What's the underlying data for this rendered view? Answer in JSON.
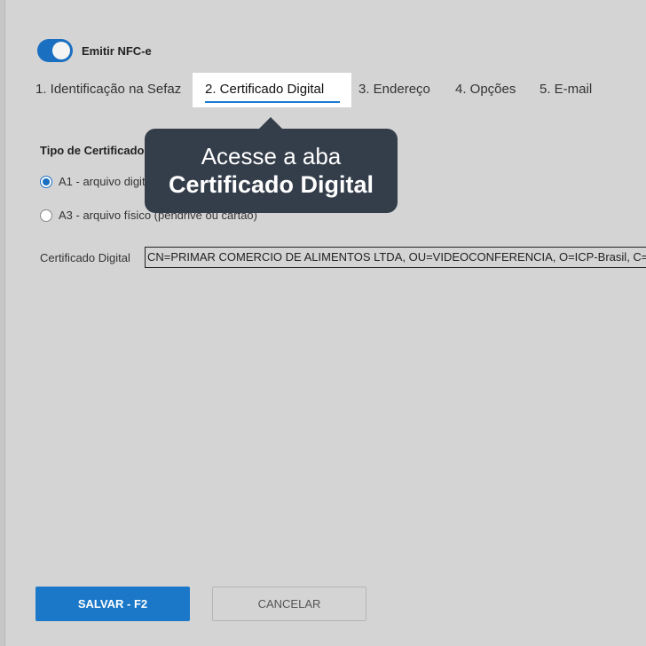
{
  "toggle": {
    "label": "Emitir NFC-e",
    "on": true
  },
  "tabs": {
    "items": [
      {
        "label": "1. Identificação na Sefaz"
      },
      {
        "label": "2. Certificado Digital",
        "active": true
      },
      {
        "label": "3. Endereço"
      },
      {
        "label": "4. Opções"
      },
      {
        "label": "5. E-mail"
      }
    ]
  },
  "form": {
    "section_title": "Tipo de Certificado",
    "radio_a1": "A1 - arquivo digital",
    "radio_a3": "A3 - arquivo físico (pendrive ou cartão)",
    "cert_label": "Certificado Digital",
    "cert_value": "CN=PRIMAR COMERCIO DE ALIMENTOS LTDA, OU=VIDEOCONFERENCIA, O=ICP-Brasil, C="
  },
  "tooltip": {
    "line1": "Acesse a aba",
    "line2": "Certificado Digital"
  },
  "buttons": {
    "save": "SALVAR - F2",
    "cancel": "CANCELAR"
  },
  "colors": {
    "accent": "#1b78c8",
    "tooltip_bg": "#343d4a",
    "background": "#d4d4d4"
  }
}
